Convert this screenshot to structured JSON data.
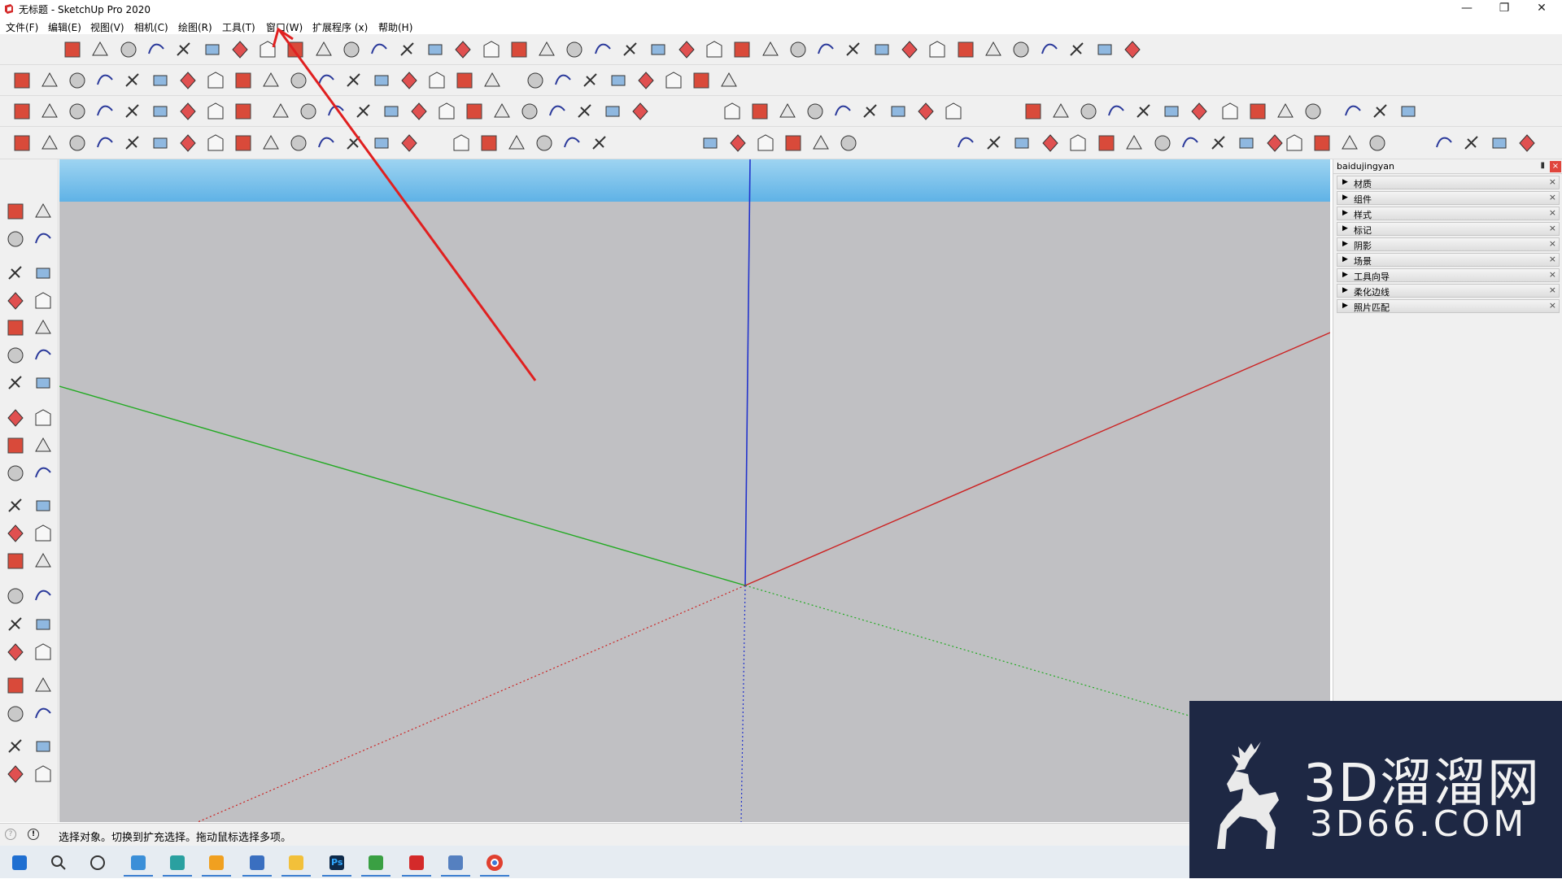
{
  "window": {
    "title": "无标题 - SketchUp Pro 2020",
    "minimize_glyph": "—",
    "restore_glyph": "❐",
    "close_glyph": "✕"
  },
  "menu": [
    {
      "label": "文件(F)"
    },
    {
      "label": "编辑(E)"
    },
    {
      "label": "视图(V)"
    },
    {
      "label": "相机(C)"
    },
    {
      "label": "绘图(R)"
    },
    {
      "label": "工具(T)"
    },
    {
      "label": "窗口(W)"
    },
    {
      "label": "扩展程序 (x)"
    },
    {
      "label": "帮助(H)"
    }
  ],
  "toolbars": {
    "row1_icon": "plugin-tool-icon",
    "row2_icon": "curve-tool-icon",
    "row3_icon": "view-tool-icon",
    "row4_icon": "main-tool-icon"
  },
  "tray": {
    "title": "baidujingyan",
    "pin_glyph": "▮",
    "close_glyph": "×",
    "panels": [
      {
        "label": "材质"
      },
      {
        "label": "组件"
      },
      {
        "label": "样式"
      },
      {
        "label": "标记"
      },
      {
        "label": "阴影"
      },
      {
        "label": "场景"
      },
      {
        "label": "工具向导"
      },
      {
        "label": "柔化边线"
      },
      {
        "label": "照片匹配"
      }
    ],
    "panel_arrow": "▶",
    "panel_close": "×"
  },
  "status": {
    "icon1": "?",
    "icon2": "!",
    "text": "选择对象。切换到扩充选择。拖动鼠标选择多项。"
  },
  "watermark": {
    "line1": "3D溜溜网",
    "line2": "3D66.COM"
  },
  "colors": {
    "axis_red": "#cc2222",
    "axis_green": "#22aa22",
    "axis_blue": "#2233cc",
    "annotation": "#e02020",
    "sky_top": "#9ed4f1",
    "ground": "#c0c0c3"
  },
  "taskbar": [
    {
      "icon": "windows-start-icon"
    },
    {
      "icon": "search-icon"
    },
    {
      "icon": "task-view-icon"
    },
    {
      "icon": "computer-icon"
    },
    {
      "icon": "app-a-icon"
    },
    {
      "icon": "browser-icon"
    },
    {
      "icon": "image-viewer-icon"
    },
    {
      "icon": "file-explorer-icon"
    },
    {
      "icon": "photoshop-icon"
    },
    {
      "icon": "green-app-icon"
    },
    {
      "icon": "sketchup-icon"
    },
    {
      "icon": "archive-icon"
    },
    {
      "icon": "chrome-icon"
    }
  ],
  "taskbar_labels": {
    "ps": "Ps"
  }
}
